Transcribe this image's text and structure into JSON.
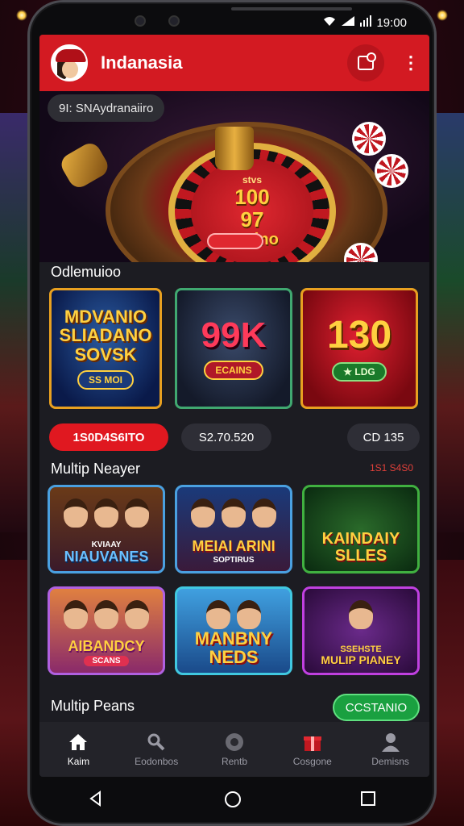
{
  "status": {
    "time": "19:00"
  },
  "app": {
    "title": "Indanasia"
  },
  "hero": {
    "pill_text": "9I: SNAydranaiiro",
    "wheel_small": "stvs",
    "wheel_line1": "100",
    "wheel_line2": "97",
    "wheel_label": "Sasino"
  },
  "section1": {
    "title": "Odlemuioo",
    "tiles": [
      {
        "title": "MDVANIO SLIADANO SOVSK",
        "sub": "SS MOI"
      },
      {
        "title": "99K",
        "sub": "ECAINS"
      },
      {
        "title": "130",
        "sub": "★ LDG"
      }
    ],
    "pills": [
      "1S0D4S6ITO",
      "S2.70.520",
      "CD  135"
    ]
  },
  "section2": {
    "title": "Multip Neayer",
    "link": "1S1 S4S0",
    "games": [
      {
        "title": "NIAUVANES",
        "top": "KVIAAY"
      },
      {
        "title": "MEIAI ARINI",
        "sub": "SOPTIRUS"
      },
      {
        "title": "KAINDAIY SLLES"
      },
      {
        "title": "AIBANDCY",
        "sub": "SCANS"
      },
      {
        "title": "MANBNY NEDS"
      },
      {
        "title": "MULIP PIANEY",
        "top": "SSEHSTE"
      }
    ]
  },
  "section3": {
    "title": "Multip Peans",
    "button": "CCSTANIO"
  },
  "nav": {
    "items": [
      {
        "label": "Kaim",
        "icon": "home-icon"
      },
      {
        "label": "Eodonbos",
        "icon": "tools-icon"
      },
      {
        "label": "Rentb",
        "icon": "chip-icon"
      },
      {
        "label": "Cosgone",
        "icon": "gift-icon"
      },
      {
        "label": "Demisns",
        "icon": "user-icon"
      }
    ],
    "active_index": 0
  },
  "colors": {
    "brand": "#d31a22",
    "accent_green": "#1aa040",
    "background": "#1c1c22"
  }
}
